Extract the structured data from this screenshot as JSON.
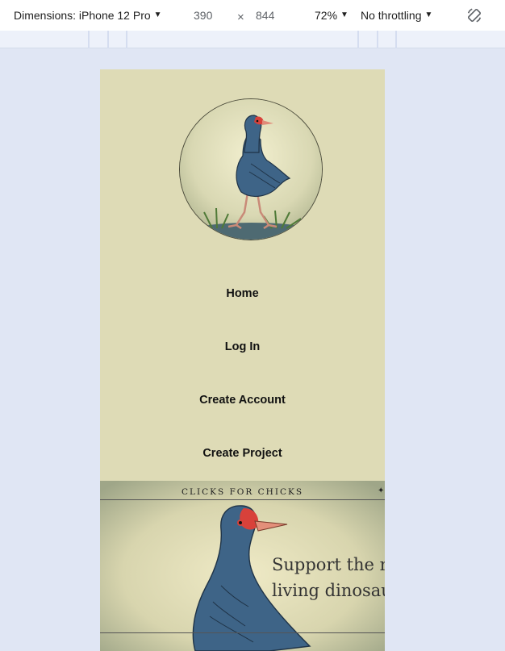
{
  "toolbar": {
    "dimensions_label": "Dimensions: iPhone 12 Pro",
    "width": "390",
    "times": "×",
    "height": "844",
    "zoom": "72%",
    "throttling": "No throttling"
  },
  "nav": {
    "items": [
      {
        "label": "Home"
      },
      {
        "label": "Log In"
      },
      {
        "label": "Create Account"
      },
      {
        "label": "Create Project"
      }
    ]
  },
  "hero": {
    "title": "CLICKS FOR CHICKS",
    "line1": "Support the nov",
    "line2": "living dinosaur"
  },
  "colors": {
    "page_bg": "#dedbb6",
    "bird_blue": "#3e6487",
    "beak_red": "#d8413a"
  }
}
